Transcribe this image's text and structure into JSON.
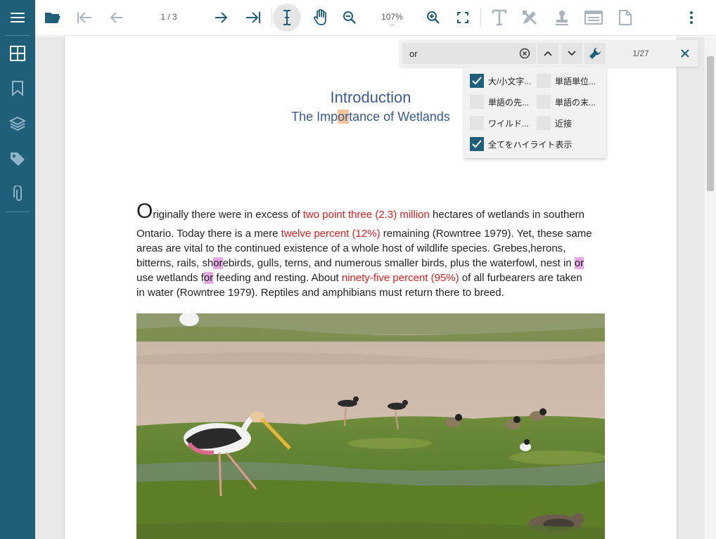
{
  "toolbar": {
    "page_indicator": "1 / 3",
    "zoom_level": "107%",
    "zoom_more": "..."
  },
  "search": {
    "value": "or",
    "match_count": "1/27",
    "options": [
      {
        "label": "大/小文字...",
        "checked": true
      },
      {
        "label": "単語単位...",
        "checked": false
      },
      {
        "label": "単語の先...",
        "checked": false
      },
      {
        "label": "単語の末...",
        "checked": false
      },
      {
        "label": "ワイルド...",
        "checked": false
      },
      {
        "label": "近接",
        "checked": false
      },
      {
        "label": "全てをハイライト表示",
        "checked": true
      }
    ]
  },
  "document": {
    "title": "Introduction",
    "subtitle": {
      "pre": "The Imp",
      "hl": "or",
      "post": "tance of Wetlands"
    },
    "lines": [
      {
        "drop": "O",
        "a": "riginally there were in excess of ",
        "red": "two point three (2.3) million",
        "b": " hectares of wetlands in southern"
      },
      {
        "a": "Ontario. Today there is a mere ",
        "red": "twelve percent (12%)",
        "b": " remaining (Rowntree 1979). Yet, these same"
      },
      {
        "a": "areas are vital to the continued existence of a whole host of wildlife species. Grebes,herons,"
      },
      {
        "a": "bitterns, rails, sh",
        "hl1": "or",
        "b": "ebirds, gulls, terns, and numerous smaller birds, plus the waterfowl, nest in ",
        "hl2": "or"
      },
      {
        "a": "use wetlands f",
        "hl1": "or",
        "b": " feeding and resting. About ",
        "red": "ninety-five percent (95%)",
        "c": " of all furbearers are taken"
      },
      {
        "a": "in water (Rowntree 1979). Reptiles and amphibians must return there to breed."
      }
    ]
  },
  "colors": {
    "rail": "#205f7a",
    "heading": "#3a5a93",
    "emphasis": "#d51f1f",
    "highlight": "#e6a9e6",
    "current_highlight": "#f8c49a"
  }
}
